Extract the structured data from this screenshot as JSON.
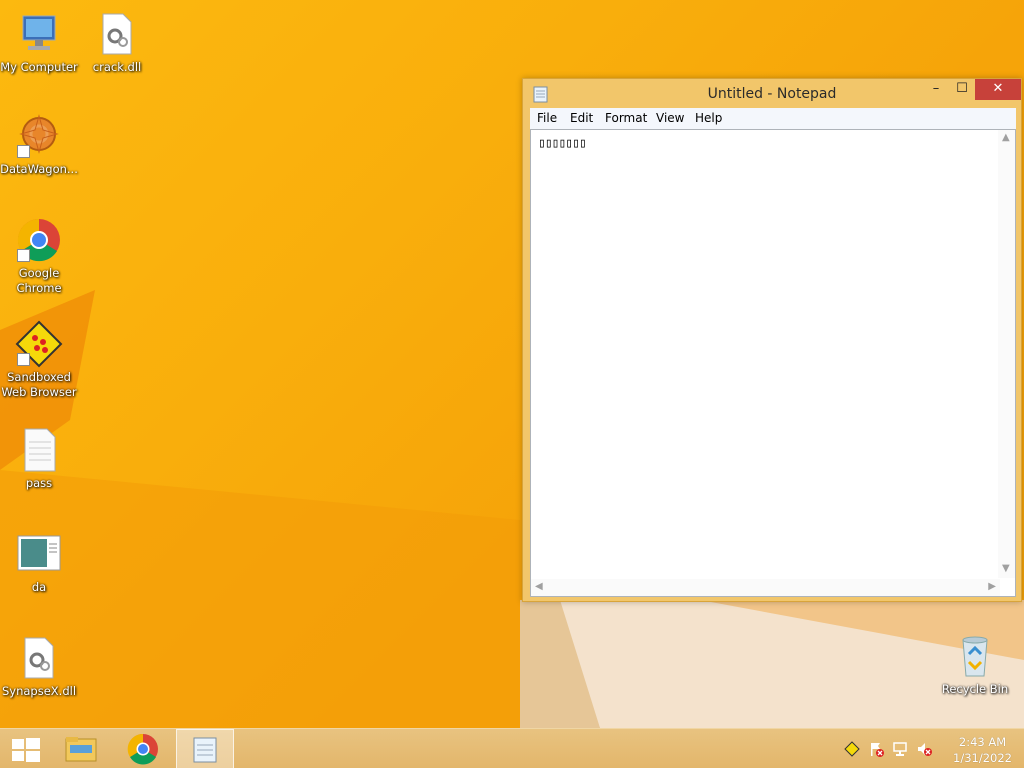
{
  "desktop": {
    "icons": [
      {
        "label": "My Computer",
        "icon": "computer-icon"
      },
      {
        "label": "crack.dll",
        "icon": "dll-file-icon"
      },
      {
        "label": "DataWagon...",
        "icon": "datawagon-icon"
      },
      {
        "label": "Google Chrome",
        "icon": "chrome-icon"
      },
      {
        "label": "Sandboxed Web Browser",
        "icon": "sandboxed-browser-icon"
      },
      {
        "label": "pass",
        "icon": "text-file-icon"
      },
      {
        "label": "da",
        "icon": "image-file-icon"
      },
      {
        "label": "SynapseX.dll",
        "icon": "dll-file-icon"
      },
      {
        "label": "Recycle Bin",
        "icon": "recycle-bin-icon"
      }
    ]
  },
  "notepad": {
    "title": "Untitled - Notepad",
    "minimize_glyph": "–",
    "maximize_glyph": "☐",
    "close_glyph": "✕",
    "menu": [
      "File",
      "Edit",
      "Format",
      "View",
      "Help"
    ],
    "content": "▯▯▯▯▯▯▯"
  },
  "taskbar": {
    "clock_time": "2:43 AM",
    "clock_date": "1/31/2022"
  },
  "colors": {
    "accent": "#f9b40e",
    "close_button": "#c7413a"
  }
}
